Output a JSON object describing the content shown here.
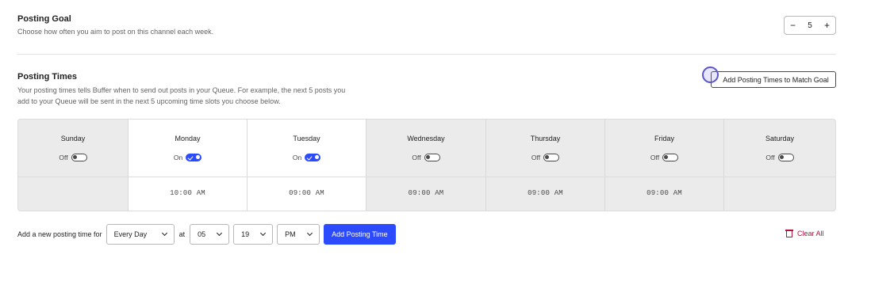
{
  "posting_goal": {
    "title": "Posting Goal",
    "description": "Choose how often you aim to post on this channel each week.",
    "stepper": {
      "minus": "−",
      "value": "5",
      "plus": "+"
    }
  },
  "posting_times": {
    "title": "Posting Times",
    "description": "Your posting times tells Buffer when to send out posts in your Queue. For example, the next 5 posts you add to your Queue will be sent in the next 5 upcoming time slots you choose below.",
    "match_button": "Add Posting Times to Match Goal"
  },
  "days": [
    {
      "name": "Sunday",
      "status": "Off",
      "on": false,
      "time": ""
    },
    {
      "name": "Monday",
      "status": "On",
      "on": true,
      "time": "10:00 AM"
    },
    {
      "name": "Tuesday",
      "status": "On",
      "on": true,
      "time": "09:00 AM"
    },
    {
      "name": "Wednesday",
      "status": "Off",
      "on": false,
      "time": "09:00 AM"
    },
    {
      "name": "Thursday",
      "status": "Off",
      "on": false,
      "time": "09:00 AM"
    },
    {
      "name": "Friday",
      "status": "Off",
      "on": false,
      "time": "09:00 AM"
    },
    {
      "name": "Saturday",
      "status": "Off",
      "on": false,
      "time": ""
    }
  ],
  "add_time": {
    "label": "Add a new posting time for",
    "frequency": "Every Day",
    "at_label": "at",
    "hour": "05",
    "minute": "19",
    "ampm": "PM",
    "add_button": "Add Posting Time"
  },
  "clear_all": "Clear All",
  "colors": {
    "accent": "#2c4bff",
    "danger": "#b0143a"
  }
}
